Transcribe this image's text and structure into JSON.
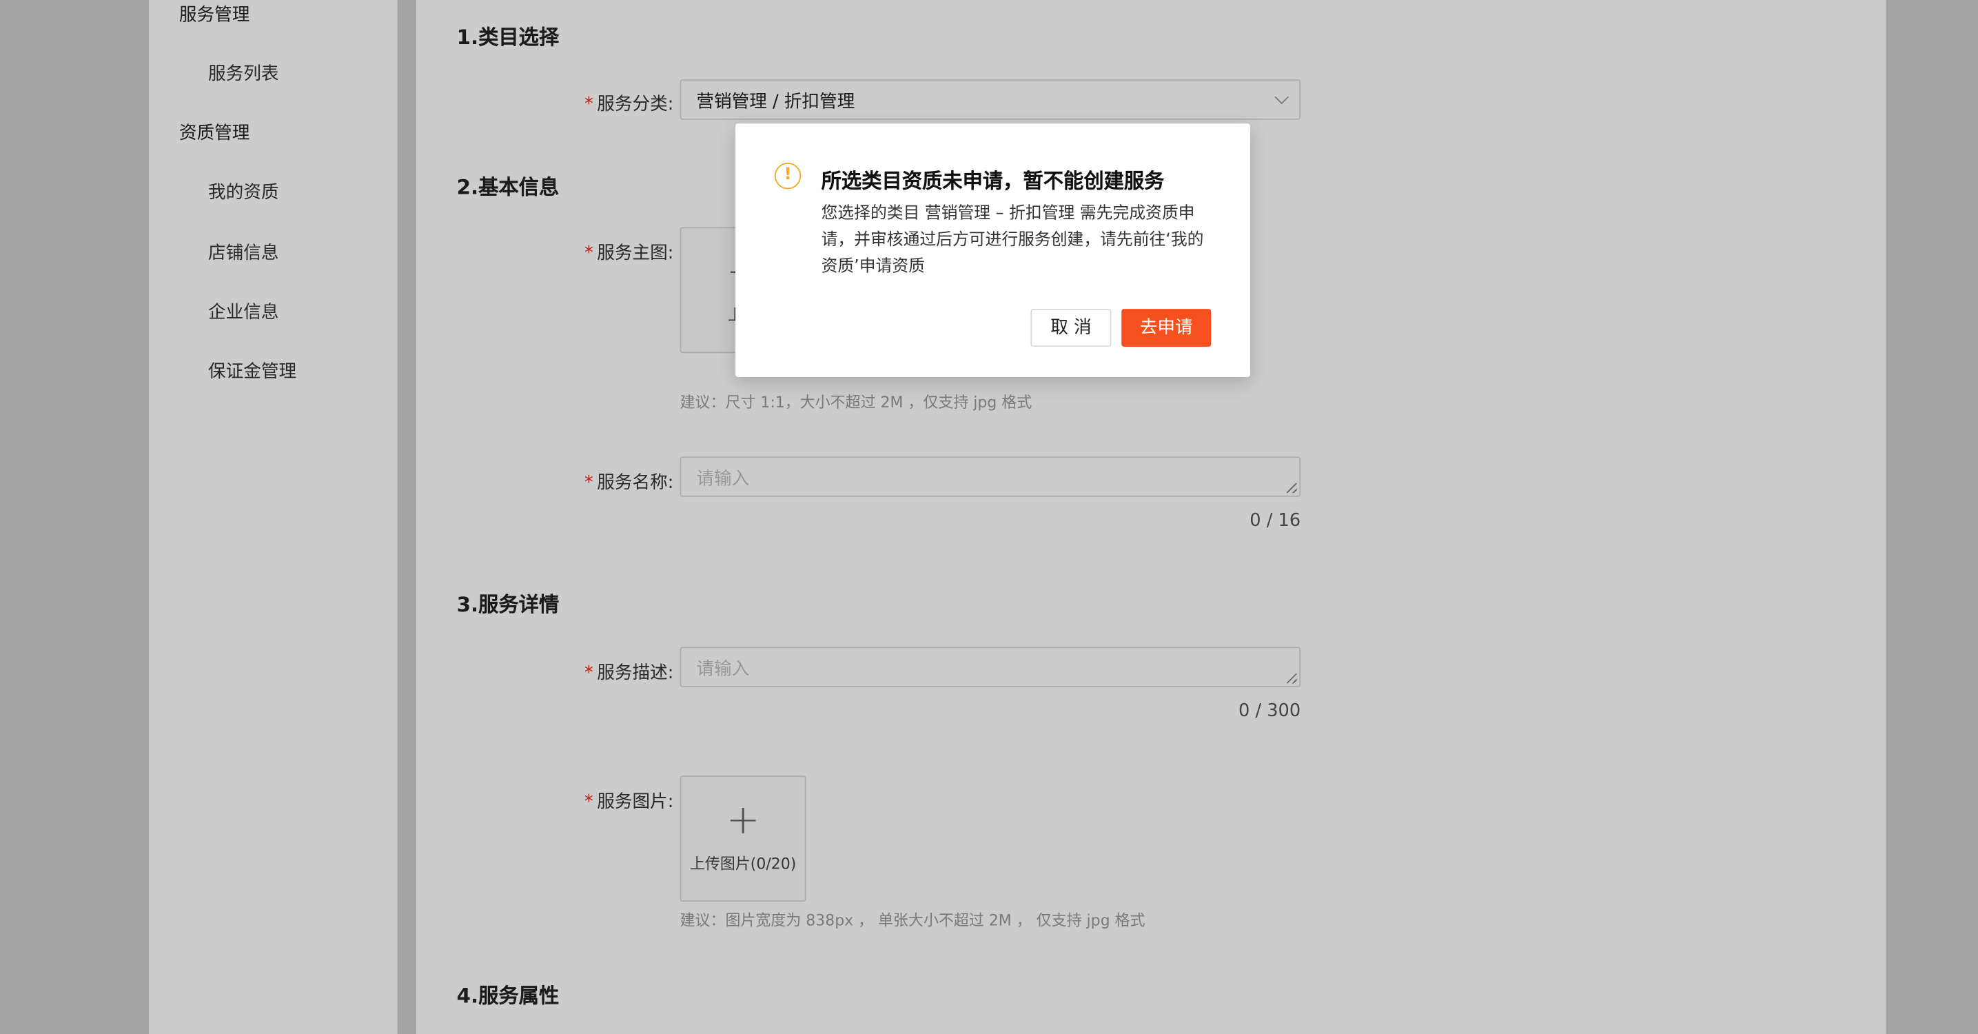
{
  "sidebar": {
    "groups": [
      {
        "label": "服务管理",
        "items": [
          "服务列表"
        ]
      },
      {
        "label": "资质管理",
        "items": [
          "我的资质",
          "店铺信息",
          "企业信息",
          "保证金管理"
        ]
      }
    ]
  },
  "form": {
    "sections": [
      "1.类目选择",
      "2.基本信息",
      "3.服务详情",
      "4.服务属性"
    ],
    "required_mark": "*",
    "category": {
      "label": "服务分类:",
      "value": "营销管理 / 折扣管理"
    },
    "main_image": {
      "label": "服务主图:",
      "upload_text": "上传",
      "hint": "建议：尺寸 1:1，大小不超过 2M ，仅支持 jpg 格式"
    },
    "service_name": {
      "label": "服务名称:",
      "placeholder": "请输入",
      "counter": "0 / 16"
    },
    "service_desc": {
      "label": "服务描述:",
      "placeholder": "请输入",
      "counter": "0 / 300"
    },
    "service_images": {
      "label": "服务图片:",
      "upload_text": "上传图片(0/20)",
      "hint": "建议：图片宽度为 838px ， 单张大小不超过 2M ， 仅支持 jpg 格式"
    }
  },
  "modal": {
    "icon": "warning-circle-icon",
    "title": "所选类目资质未申请，暂不能创建服务",
    "body": "您选择的类目 营销管理 – 折扣管理 需先完成资质申请，并审核通过后方可进行服务创建，请先前往‘我的资质’申请资质",
    "cancel_label": "取 消",
    "ok_label": "去申请",
    "accent_color": "#f5501e",
    "warning_color": "#f5a623"
  }
}
